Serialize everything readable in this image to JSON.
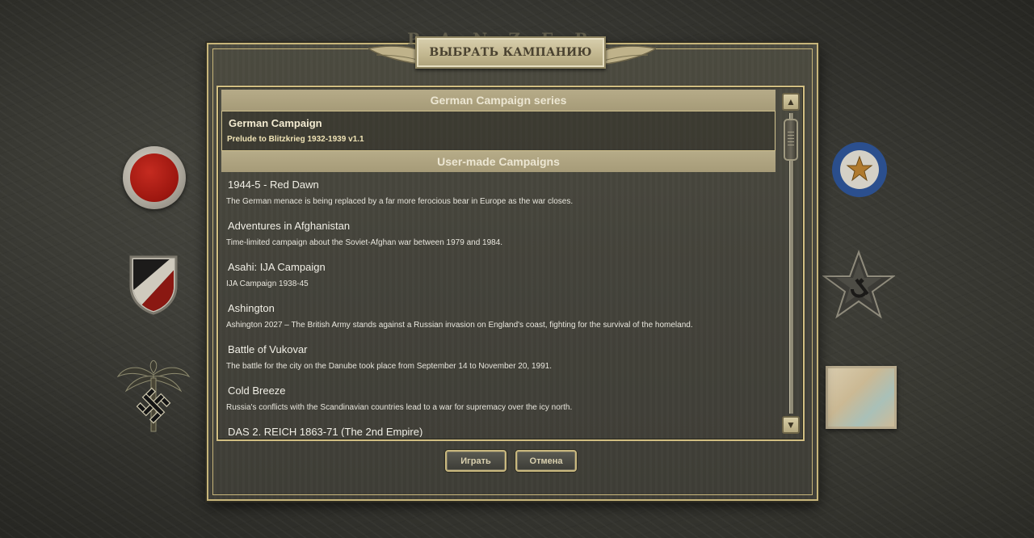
{
  "dialog": {
    "brand_text": "PANZER CORPS",
    "title": "ВЫБРАТЬ КАМПАНИЮ"
  },
  "groups": [
    {
      "header": "German Campaign series",
      "items": [
        {
          "name": "German Campaign",
          "description": "Prelude to Blitzkrieg 1932-1939 v1.1",
          "selected": true
        }
      ]
    },
    {
      "header": "User-made Campaigns",
      "items": [
        {
          "name": "1944-5 - Red Dawn",
          "description": "The German menace is being replaced by a far more ferocious bear in Europe as the war closes."
        },
        {
          "name": "Adventures in Afghanistan",
          "description": "Time-limited campaign about the Soviet-Afghan war between 1979 and 1984."
        },
        {
          "name": "Asahi: IJA Campaign",
          "description": "IJA Campaign 1938-45"
        },
        {
          "name": "Ashington",
          "description": "Ashington 2027 – The British Army stands against a Russian invasion on England's coast, fighting for the survival of the homeland."
        },
        {
          "name": "Battle of Vukovar",
          "description": "The battle for the city on the Danube took place from September 14 to November 20, 1991."
        },
        {
          "name": "Cold Breeze",
          "description": "Russia's conflicts with the Scandinavian countries lead to a war for supremacy over the icy north."
        },
        {
          "name": "DAS 2. REICH 1863-71 (The 2nd Empire)",
          "description": ""
        }
      ]
    }
  ],
  "scrollbar": {
    "up_glyph": "▲",
    "down_glyph": "▼",
    "position": 0.03
  },
  "buttons": {
    "play_label": "Играть",
    "cancel_label": "Отмена"
  },
  "colors": {
    "accent_gold": "#c7b57a",
    "header_bg": "#b6ab88",
    "panel_bg": "#43423a"
  },
  "emblems": [
    "red-roundel-icon",
    "black-white-red-shield-icon",
    "palm-swastika-icon",
    "blue-roundel-star-icon",
    "soviet-star-icon",
    "map-thumbnail-icon"
  ]
}
